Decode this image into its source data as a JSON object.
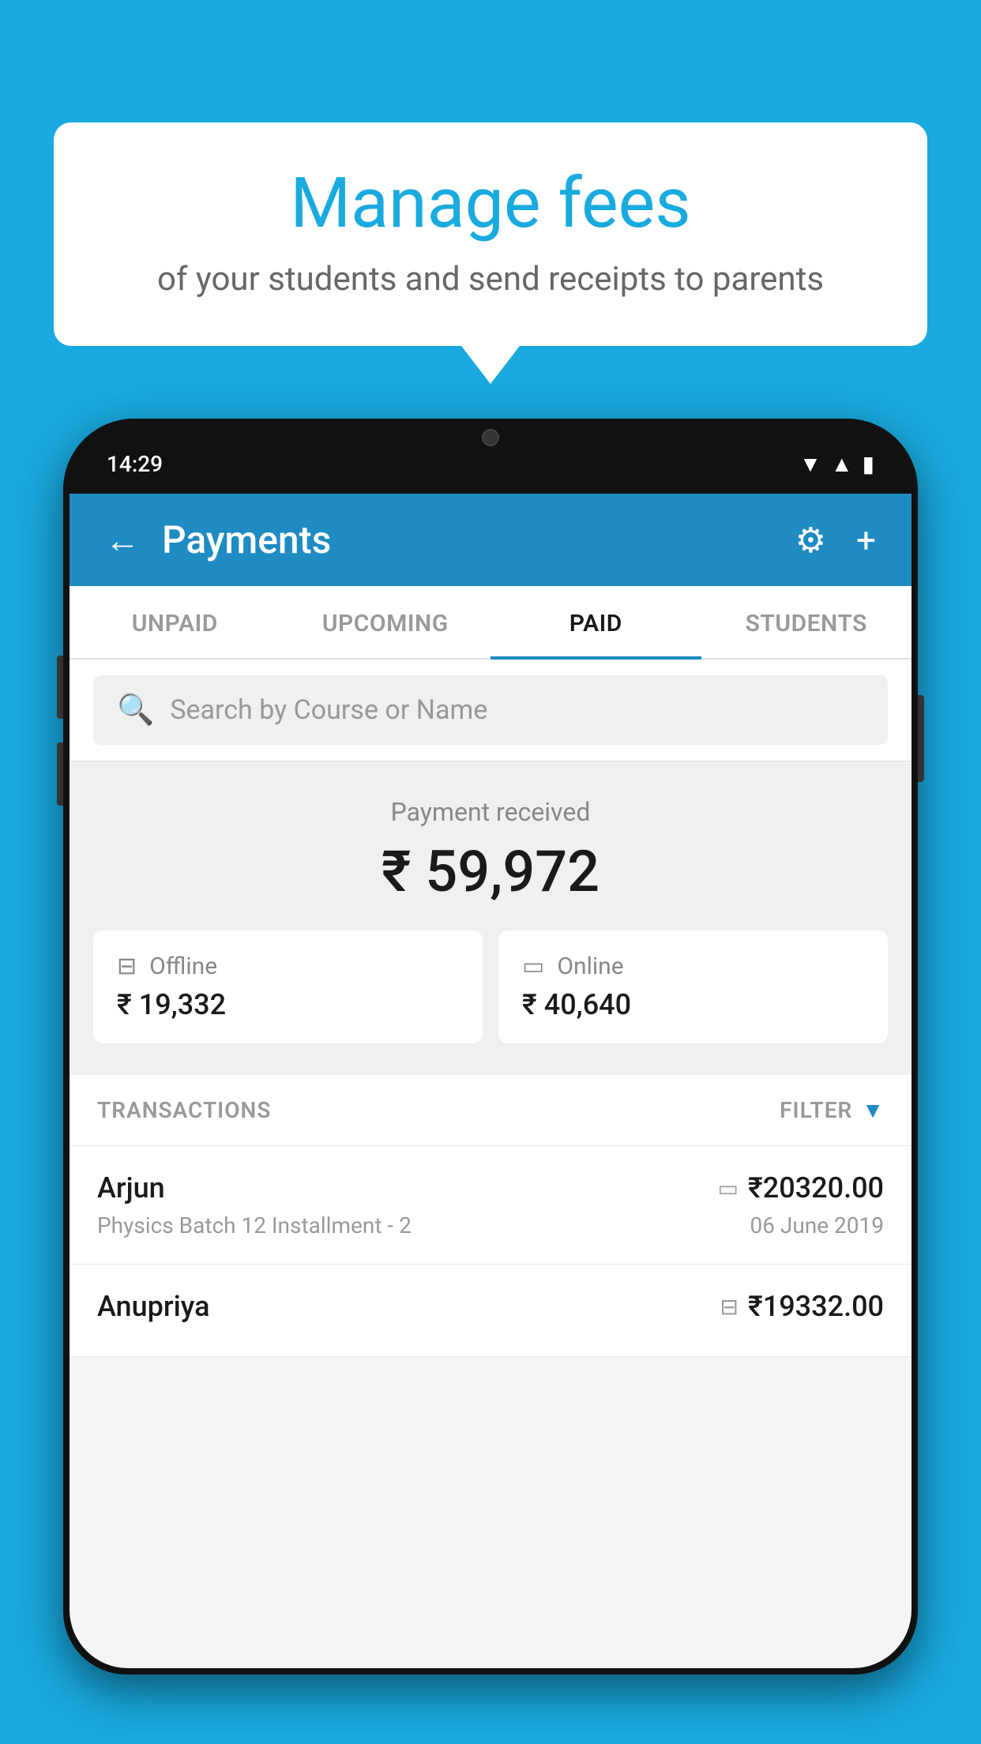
{
  "bubble": {
    "title": "Manage fees",
    "subtitle": "of your students and send receipts to parents"
  },
  "status_bar": {
    "time": "14:29"
  },
  "header": {
    "title": "Payments",
    "back_label": "←",
    "gear_label": "⚙",
    "plus_label": "+"
  },
  "tabs": [
    {
      "label": "UNPAID",
      "active": false
    },
    {
      "label": "UPCOMING",
      "active": false
    },
    {
      "label": "PAID",
      "active": true
    },
    {
      "label": "STUDENTS",
      "active": false
    }
  ],
  "search": {
    "placeholder": "Search by Course or Name"
  },
  "payment": {
    "received_label": "Payment received",
    "total_amount": "₹ 59,972",
    "offline_label": "Offline",
    "offline_amount": "₹ 19,332",
    "online_label": "Online",
    "online_amount": "₹ 40,640"
  },
  "transactions": {
    "label": "TRANSACTIONS",
    "filter_label": "FILTER",
    "rows": [
      {
        "name": "Arjun",
        "detail": "Physics Batch 12 Installment - 2",
        "amount": "₹20320.00",
        "date": "06 June 2019",
        "payment_type": "online"
      },
      {
        "name": "Anupriya",
        "detail": "",
        "amount": "₹19332.00",
        "date": "",
        "payment_type": "offline"
      }
    ]
  }
}
